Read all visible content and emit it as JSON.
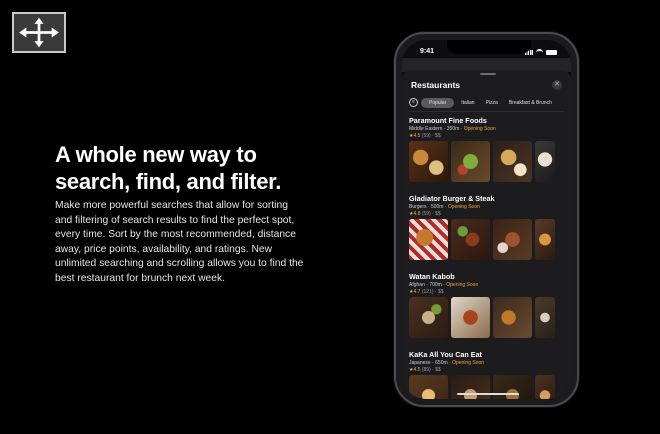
{
  "headline": {
    "line1": "A whole new way to",
    "line2": "search, find, and filter."
  },
  "body": "Make more powerful searches that allow for sorting and filtering of search results to find the perfect spot, every time. Sort by the most recommended, distance away, price points, availability, and ratings. New unlimited searching and scrolling allows you to find the best restaurant for brunch next week.",
  "phone": {
    "time": "9:41",
    "sheet_title": "Restaurants",
    "close_glyph": "✕",
    "filters": [
      "Popular",
      "Italian",
      "Pizza",
      "Breakfast & Brunch"
    ],
    "restaurants": [
      {
        "name": "Paramount Fine Foods",
        "meta": "Middle Eastern · 350m · ",
        "status": "Opening Soon",
        "rating": "4.5",
        "rating_rest": " (59) · $$"
      },
      {
        "name": "Gladiator Burger & Steak",
        "meta": "Burgers · 500m · ",
        "status": "Opening Soon",
        "rating": "4.8",
        "rating_rest": " (59) · $$"
      },
      {
        "name": "Watan Kabob",
        "meta": "Afghan · 700m · ",
        "status": "Opening Soon",
        "rating": "4.7",
        "rating_rest": " (121) · $$"
      },
      {
        "name": "KaKa All You Can Eat",
        "meta": "Japanese · 650m · ",
        "status": "Opening Soon",
        "rating": "4.5",
        "rating_rest": " (89) · $$"
      }
    ]
  },
  "icons": {
    "expand": "expand-arrows-icon",
    "filter": "filter-icon",
    "star": "star-icon",
    "close": "close-icon"
  },
  "colors": {
    "accent": "#f0a63c",
    "background": "#000000",
    "sheet": "#1c1c1e"
  }
}
